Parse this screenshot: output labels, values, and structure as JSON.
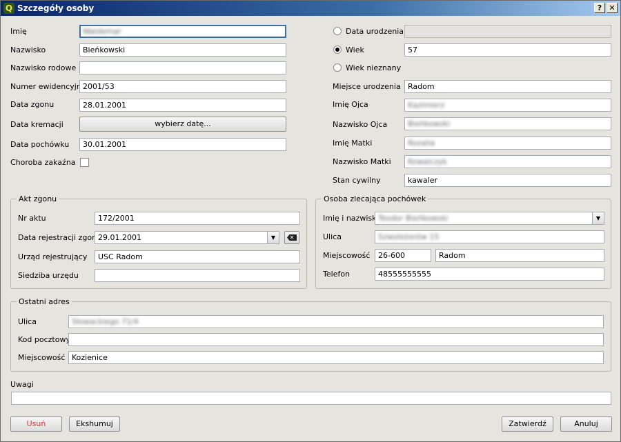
{
  "window": {
    "title": "Szczegóły osoby",
    "help_label": "?",
    "close_label": "✕"
  },
  "person": {
    "imie": {
      "label": "Imię",
      "value": "Waldemar"
    },
    "nazwisko": {
      "label": "Nazwisko",
      "value": "Bieńkowski"
    },
    "nazwisko_rodowe": {
      "label": "Nazwisko rodowe",
      "value": ""
    },
    "numer": {
      "label": "Numer ewidencyjny",
      "value": "2001/53"
    },
    "data_zgonu": {
      "label": "Data zgonu",
      "value": "28.01.2001"
    },
    "data_kremacji": {
      "label": "Data kremacji",
      "button": "wybierz datę..."
    },
    "data_pochowku": {
      "label": "Data pochówku",
      "value": "30.01.2001"
    },
    "choroba": {
      "label": "Choroba zakaźna",
      "checked": false
    }
  },
  "right": {
    "data_urodzenia": {
      "label": "Data urodzenia",
      "value": "",
      "selected": false
    },
    "wiek": {
      "label": "Wiek",
      "value": "57",
      "selected": true
    },
    "wiek_nieznany": {
      "label": "Wiek nieznany",
      "selected": false
    },
    "miejsce": {
      "label": "Miejsce urodzenia",
      "value": "Radom"
    },
    "imie_ojca": {
      "label": "Imię Ojca",
      "value": "Kazimierz"
    },
    "nazwisko_ojca": {
      "label": "Nazwisko Ojca",
      "value": "Bieńkowski"
    },
    "imie_matki": {
      "label": "Imię Matki",
      "value": "Rozalia"
    },
    "nazwisko_matki": {
      "label": "Nazwisko Matki",
      "value": "Kowalczyk"
    },
    "stan": {
      "label": "Stan cywilny",
      "value": "kawaler"
    }
  },
  "akt": {
    "title": "Akt zgonu",
    "nr": {
      "label": "Nr aktu",
      "value": "172/2001"
    },
    "data_rej": {
      "label": "Data rejestracji zgonu",
      "value": "29.01.2001"
    },
    "urzad": {
      "label": "Urząd rejestrujący",
      "value": "USC Radom"
    },
    "siedziba": {
      "label": "Siedziba urzędu",
      "value": ""
    }
  },
  "osoba": {
    "title": "Osoba zlecająca pochówek",
    "imie_nazwisko": {
      "label": "Imię i nazwisko",
      "value": "Teodor Bieńkowski"
    },
    "ulica": {
      "label": "Ulica",
      "value": "Szwoleżerów 15"
    },
    "miejscowosc": {
      "label": "Miejscowość",
      "kod": "26-600",
      "value": "Radom"
    },
    "telefon": {
      "label": "Telefon",
      "value": "48555555555"
    }
  },
  "adres": {
    "title": "Ostatni adres",
    "ulica": {
      "label": "Ulica",
      "value": "Słowackiego 71/4"
    },
    "kod": {
      "label": "Kod pocztowy",
      "value": ""
    },
    "miejscowosc": {
      "label": "Miejscowość",
      "value": "Kozienice"
    }
  },
  "uwagi": {
    "label": "Uwagi",
    "value": ""
  },
  "buttons": {
    "usun": "Usuń",
    "ekshumuj": "Ekshumuj",
    "zatwierdz": "Zatwierdź",
    "anuluj": "Anuluj"
  },
  "colors": {
    "danger_text": "#e03030",
    "focus_border": "#3c6ea8",
    "title_start": "#0a246a",
    "title_end": "#a6caf0"
  }
}
